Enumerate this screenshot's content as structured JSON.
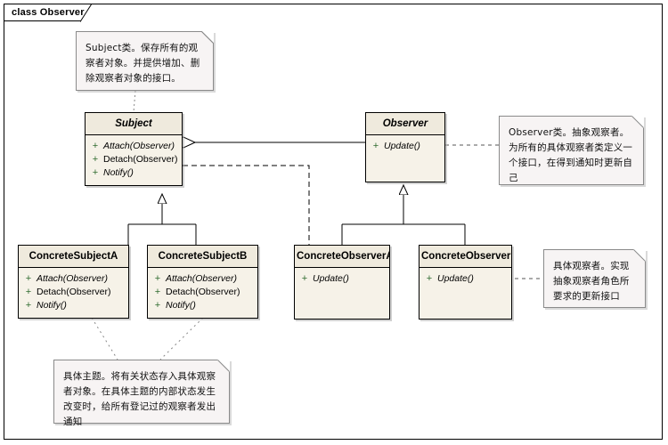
{
  "frame": {
    "tab_label": "class Observer"
  },
  "classes": [
    {
      "id": "subject",
      "name": "Subject",
      "kind": "abstract",
      "members": [
        {
          "visibility": "+",
          "name": "Attach(Observer)",
          "italic": true
        },
        {
          "visibility": "+",
          "name": "Detach(Observer)",
          "italic": false
        },
        {
          "visibility": "+",
          "name": "Notify()",
          "italic": true
        }
      ]
    },
    {
      "id": "observer",
      "name": "Observer",
      "kind": "abstract",
      "members": [
        {
          "visibility": "+",
          "name": "Update()",
          "italic": true
        }
      ]
    },
    {
      "id": "concrete-subject-a",
      "name": "ConcreteSubjectA",
      "kind": "concrete",
      "members": [
        {
          "visibility": "+",
          "name": "Attach(Observer)",
          "italic": true
        },
        {
          "visibility": "+",
          "name": "Detach(Observer)",
          "italic": false
        },
        {
          "visibility": "+",
          "name": "Notify()",
          "italic": true
        }
      ]
    },
    {
      "id": "concrete-subject-b",
      "name": "ConcreteSubjectB",
      "kind": "concrete",
      "members": [
        {
          "visibility": "+",
          "name": "Attach(Observer)",
          "italic": true
        },
        {
          "visibility": "+",
          "name": "Detach(Observer)",
          "italic": false
        },
        {
          "visibility": "+",
          "name": "Notify()",
          "italic": true
        }
      ]
    },
    {
      "id": "concrete-observer-a",
      "name": "ConcreteObserverA",
      "kind": "concrete",
      "members": [
        {
          "visibility": "+",
          "name": "Update()",
          "italic": true
        }
      ]
    },
    {
      "id": "concrete-observer-b",
      "name": "ConcreteObserverB",
      "kind": "concrete",
      "members": [
        {
          "visibility": "+",
          "name": "Update()",
          "italic": true
        }
      ]
    }
  ],
  "notes": [
    {
      "id": "note-subject",
      "text": "Subject类。保存所有的观察者对象。并提供增加、删除观察者对象的接口。"
    },
    {
      "id": "note-observer",
      "text": "Observer类。抽象观察者。为所有的具体观察者类定义一个接口，在得到通知时更新自己"
    },
    {
      "id": "note-concrete-observer",
      "text": "具体观察者。实现抽象观察者角色所要求的更新接口"
    },
    {
      "id": "note-concrete-subject",
      "text": "具体主题。将有关状态存入具体观察者对象。在具体主题的内部状态发生改变时，给所有登记过的观察者发出通知"
    }
  ],
  "colors": {
    "class_header_fill": "#efeadd",
    "class_body_fill": "#f6f2e8",
    "class_border": "#000000",
    "note_fill": "#f7f4f4",
    "note_border": "#8a8a8a",
    "visibility_marker": "#2f6b2f",
    "edge_line": "#000000",
    "canvas": "#ffffff"
  }
}
